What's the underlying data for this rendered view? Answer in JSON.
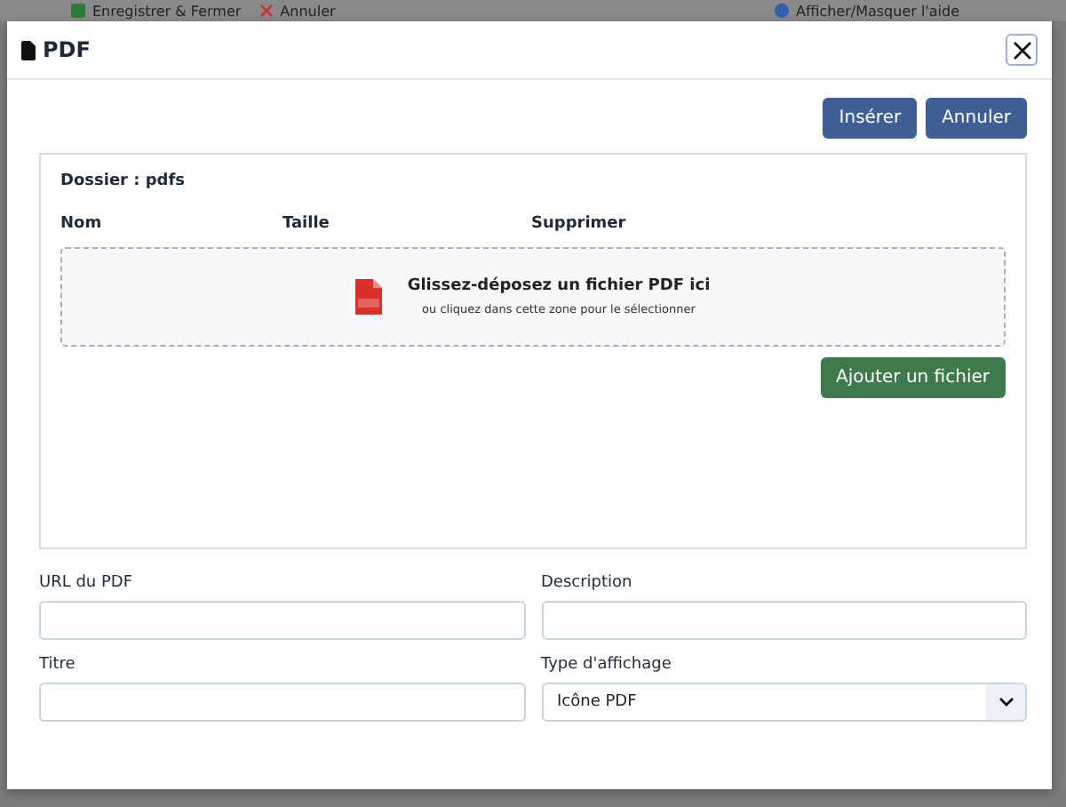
{
  "background_toolbar": {
    "buttons": [
      {
        "kind": "save",
        "label": "Enregistrer & Fermer"
      },
      {
        "kind": "cancel",
        "label": "Annuler"
      },
      {
        "kind": "help",
        "label": "Afficher/Masquer l'aide"
      }
    ]
  },
  "dialog": {
    "title": "PDF",
    "actions": [
      {
        "kind": "primary",
        "label": "Insérer"
      },
      {
        "kind": "primary",
        "label": "Annuler"
      }
    ],
    "folder": {
      "label": "Dossier : pdfs",
      "columns": [
        "Nom",
        "Taille",
        "Supprimer"
      ],
      "dropzone": {
        "title": "Glissez-déposez un fichier PDF ici",
        "hint": "ou cliquez dans cette zone pour le sélectionner"
      },
      "add_button": "Ajouter un fichier"
    },
    "fields": [
      {
        "kind": "text",
        "label": "URL du PDF"
      },
      {
        "kind": "text",
        "label": "Description"
      },
      {
        "kind": "text",
        "label": "Titre"
      },
      {
        "kind": "select",
        "label": "Type d'affichage",
        "value": "Icône PDF"
      }
    ]
  }
}
